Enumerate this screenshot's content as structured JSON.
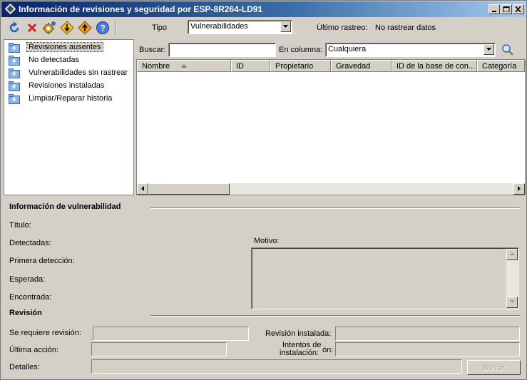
{
  "window": {
    "title": "Información de revisiones y seguridad por ESP-8R264-LD91"
  },
  "toolbar": {
    "icons": [
      "refresh-icon",
      "delete-icon",
      "settings-gear-icon",
      "install-icon",
      "approve-icon",
      "help-icon"
    ],
    "tipo_label": "Tipo",
    "tipo_value": "Vulnerabilidades",
    "ultimo_rastreo_label": "Último rastreo:",
    "ultimo_rastreo_value": "No rastrear datos"
  },
  "tree": {
    "items": [
      {
        "label": "Revisiones ausentes",
        "selected": true
      },
      {
        "label": "No detectadas",
        "selected": false
      },
      {
        "label": "Vulnerabilidades sin rastrear",
        "selected": false
      },
      {
        "label": "Revisiones instaladas",
        "selected": false
      },
      {
        "label": "Limpiar/Reparar historia",
        "selected": false
      }
    ]
  },
  "search": {
    "buscar_label": "Buscar:",
    "buscar_value": "",
    "columna_label": "En columna:",
    "columna_value": "Cualquiera"
  },
  "list": {
    "columns": [
      "Nombre",
      "ID",
      "Propietario",
      "Gravedad",
      "ID de la base de con...",
      "Categoría"
    ],
    "rows": []
  },
  "vulnerability": {
    "section_title": "Información de vulnerabilidad",
    "titulo_label": "Título:",
    "detectadas_label": "Detectadas:",
    "primera_deteccion_label": "Primera detección:",
    "esperada_label": "Esperada:",
    "encontrada_label": "Encontrada:",
    "motivo_label": "Motivo:"
  },
  "revision": {
    "section_title": "Revisión",
    "se_requiere_label": "Se requiere revisión:",
    "ultima_accion_label": "Última acción:",
    "detalles_label": "Detalles:",
    "instalada_label": "Revisión instalada:",
    "intentos_label_line1": "Intentos de",
    "intentos_label_line2": "instalación:",
    "intentos_suffix": "ón:",
    "borrar_label": "Borrar"
  }
}
